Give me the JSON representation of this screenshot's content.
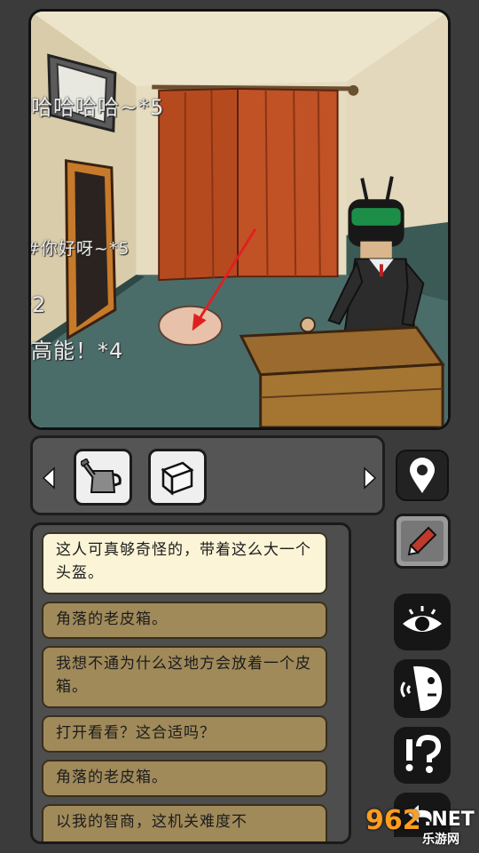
{
  "scene": {
    "danmaku": [
      "哈哈哈哈~*5",
      "#你好呀~*5",
      "*2",
      "高能！*4"
    ]
  },
  "inventory": {
    "items": [
      {
        "name": "watering-can"
      },
      {
        "name": "white-cube"
      }
    ]
  },
  "dialogue": {
    "options": [
      "这人可真够奇怪的，带着这么大一个头盔。",
      "角落的老皮箱。",
      "我想不通为什么这地方会放着一个皮箱。",
      "打开看看？这合适吗？",
      "角落的老皮箱。",
      "以我的智商，这机关难度不"
    ],
    "selected_index": 0
  },
  "watermark": {
    "number": "962",
    "suffix": ".NET",
    "sub": "乐游网"
  },
  "colors": {
    "curtain": "#b64a1f",
    "option_bg": "#a08a5a",
    "option_selected_bg": "#fbf4d6",
    "panel_bg": "#4e4e4e",
    "arrow": "#e02020"
  }
}
